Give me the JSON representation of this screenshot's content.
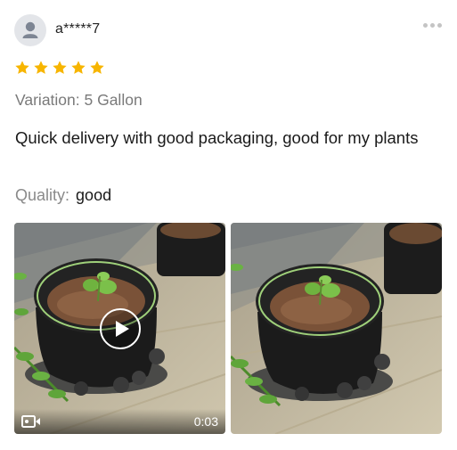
{
  "review": {
    "username": "a*****7",
    "rating": 5,
    "rating_max": 5,
    "variation_label": "Variation: 5 Gallon",
    "text": "Quick delivery with good packaging, good for my plants",
    "quality_label": "Quality:",
    "quality_value": "good"
  },
  "media": {
    "video": {
      "duration": "0:03",
      "icon": "video-camera-icon",
      "play_icon": "play-icon"
    },
    "photo": {
      "type": "image"
    }
  },
  "icons": {
    "avatar": "user-avatar-icon",
    "more": "more-options-icon",
    "star": "star-icon"
  },
  "colors": {
    "star": "#f7b500",
    "secondary_text": "#7a7a7a",
    "primary_text": "#1a1a1a",
    "avatar_bg": "#e3e5e9"
  }
}
